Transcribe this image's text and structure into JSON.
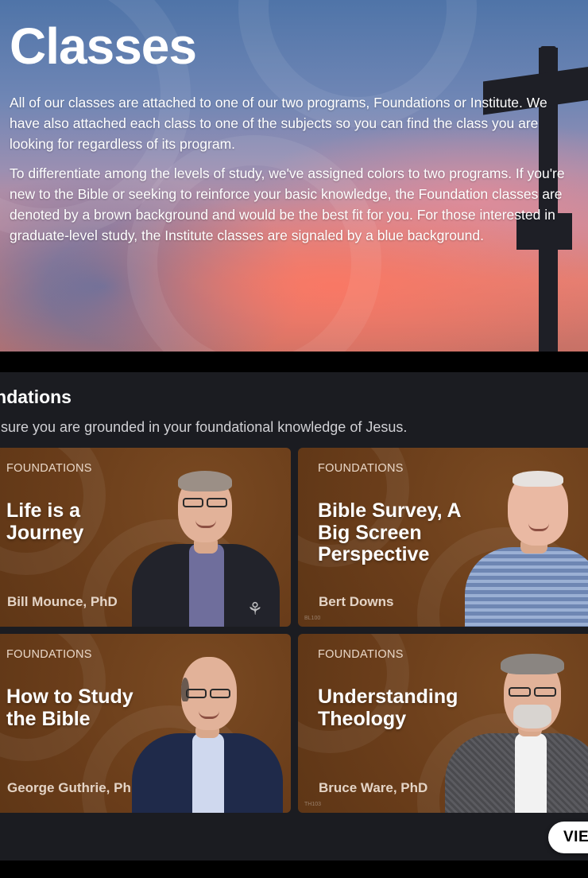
{
  "hero": {
    "title": "Classes",
    "paragraph1": "All of our classes are attached to one of our two programs, Foundations or Institute. We have also attached each class to one of the subjects so you can find the class you are looking for regardless of its program.",
    "paragraph2": "To differentiate among the levels of study, we've assigned colors to two programs. If you're new to the Bible or seeking to reinforce your basic knowledge, the Foundation classes are denoted by a brown background and would be the best fit for you. For those interested in graduate-level study, the Institute classes are signaled by a blue background."
  },
  "section": {
    "title": "Foundations",
    "subtitle": "Make sure you are grounded in your foundational knowledge of Jesus.",
    "view_button": "VIEW ALL"
  },
  "cards": [
    {
      "tag": "FOUNDATIONS",
      "title": "Life is a Journey",
      "author": "Bill Mounce, PhD",
      "code": ""
    },
    {
      "tag": "FOUNDATIONS",
      "title": "Bible Survey, A Big Screen Perspective",
      "author": "Bert Downs",
      "code": "BL100"
    },
    {
      "tag": "FOUNDATIONS",
      "title": "How to Study the Bible",
      "author": "George Guthrie, PhD",
      "code": ""
    },
    {
      "tag": "FOUNDATIONS",
      "title": "Understanding Theology",
      "author": "Bruce Ware, PhD",
      "code": "TH103"
    }
  ],
  "colors": {
    "foundations_brown": "#6a3d1a",
    "section_bg": "#1b1c21"
  }
}
